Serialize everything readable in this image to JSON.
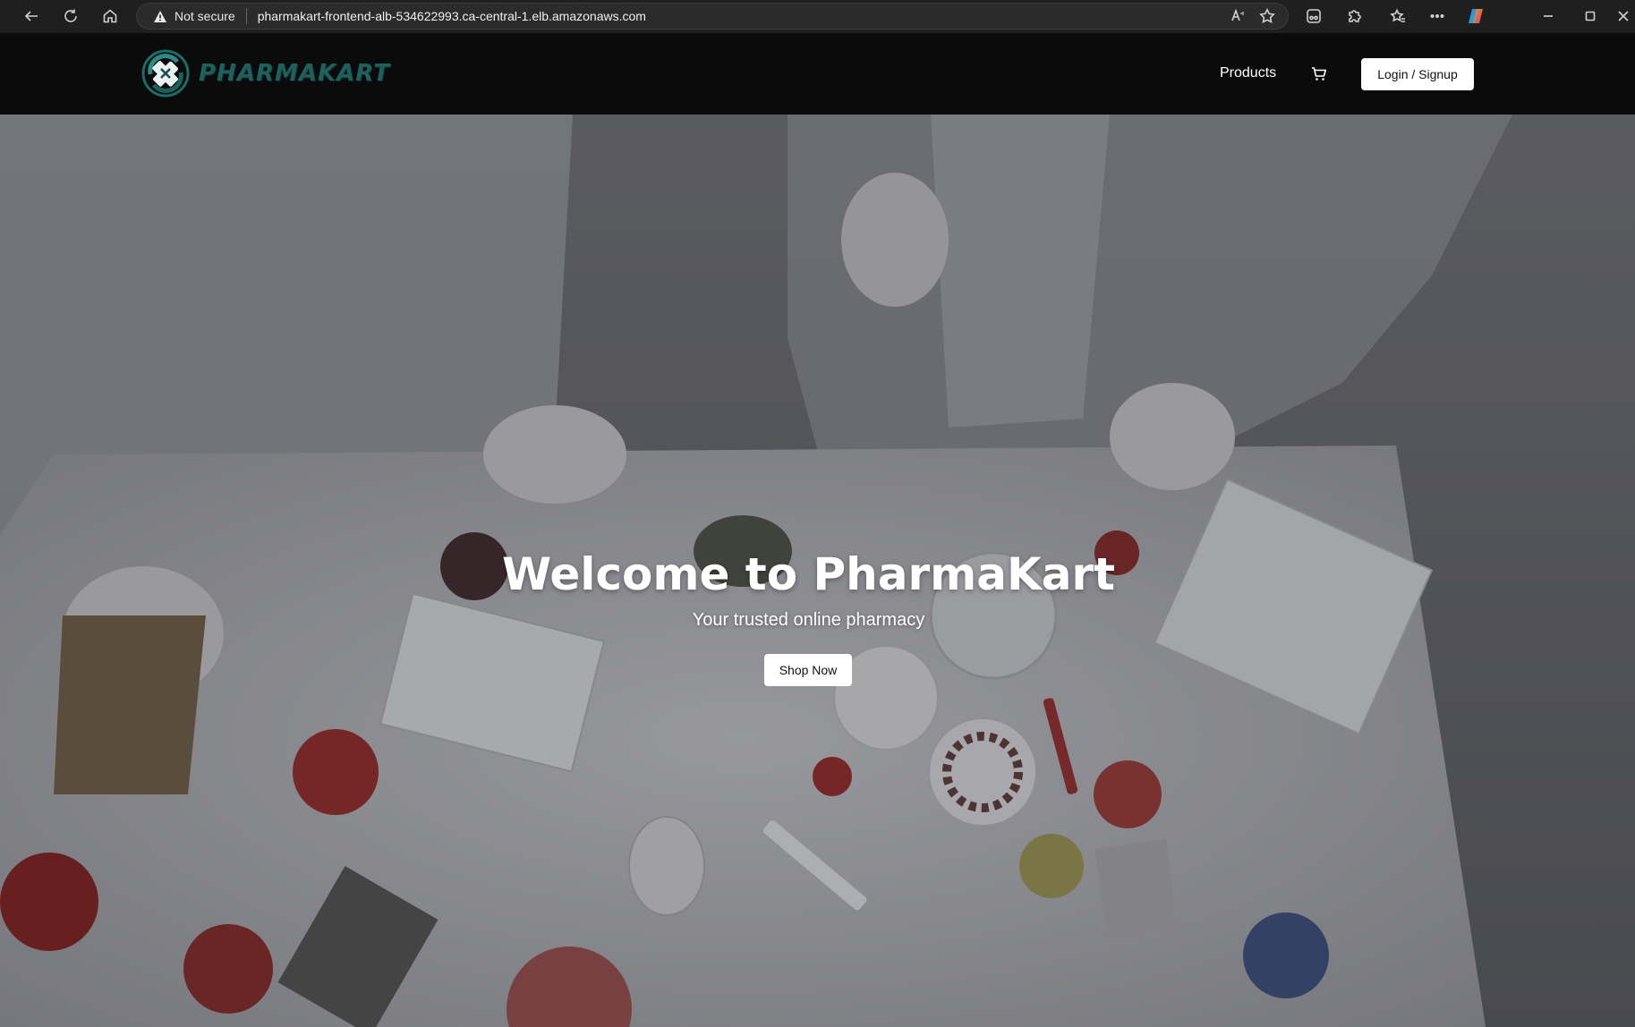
{
  "browser": {
    "security_label": "Not secure",
    "url": "pharmakart-frontend-alb-534622993.ca-central-1.elb.amazonaws.com"
  },
  "header": {
    "logo_text": "PHARMAKART",
    "nav_products": "Products",
    "login_label": "Login / Signup",
    "brand_color": "#1f5f5c"
  },
  "hero": {
    "title": "Welcome to PharmaKart",
    "subtitle": "Your trusted online pharmacy",
    "cta_label": "Shop Now"
  }
}
